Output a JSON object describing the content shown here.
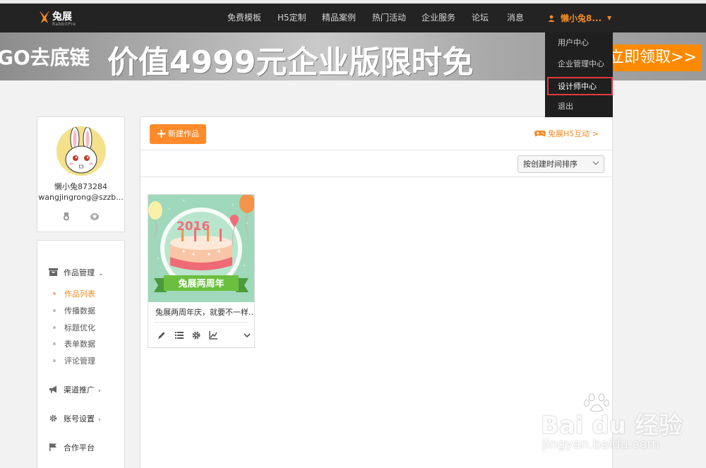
{
  "nav": {
    "logo_text": "兔展",
    "logo_sub": "RabbitPre",
    "items": [
      "免费模板",
      "H5定制",
      "精品案例",
      "热门活动",
      "企业服务",
      "论坛",
      "消息"
    ],
    "user_label": "懒小兔8..."
  },
  "banner": {
    "left_text": "GO去底链",
    "main_text": "价值4999元企业版限时免",
    "cta_text": "立即领取>>"
  },
  "dropdown": {
    "items": [
      "用户中心",
      "企业管理中心",
      "设计师中心",
      "退出"
    ],
    "active_index": 2
  },
  "profile": {
    "name": "懒小兔873284",
    "email": "wangjingrong@szzb..."
  },
  "sidebar": {
    "works_label": "作品管理",
    "works_arrow": "⌄",
    "sub_items": [
      "作品列表",
      "传播数据",
      "标题优化",
      "表单数据",
      "评论管理"
    ],
    "active_sub": 0,
    "channel_label": "渠道推广",
    "account_label": "账号设置",
    "partner_label": "合作平台",
    "arrow": "›"
  },
  "main": {
    "new_button": "新建作品",
    "new_plus": "+",
    "h5_link": "兔展H5互动 >",
    "sort_label": "按创建时间排序"
  },
  "card": {
    "title": "兔展两周年庆，就要不一样...",
    "thumb_year": "2016",
    "thumb_ribbon": "兔展两周年"
  },
  "watermark": {
    "text": "Bai du 经验",
    "url": "jingyan.baidu.com"
  },
  "colors": {
    "accent": "#f08a24",
    "nav_bg": "#232323",
    "highlight_border": "#e4393c"
  }
}
